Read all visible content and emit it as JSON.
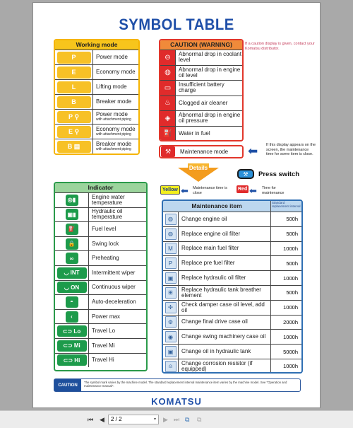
{
  "document": {
    "title": "SYMBOL TABLE",
    "brand": "KOMATSU",
    "working_mode": {
      "header": "Working mode",
      "items": [
        {
          "symbol": "P",
          "label": "Power mode",
          "sub": ""
        },
        {
          "symbol": "E",
          "label": "Economy mode",
          "sub": ""
        },
        {
          "symbol": "L",
          "label": "Lifting mode",
          "sub": ""
        },
        {
          "symbol": "B",
          "label": "Breaker mode",
          "sub": ""
        },
        {
          "symbol": "P ⚲",
          "label": "Power mode",
          "sub": "with attachment piping"
        },
        {
          "symbol": "E ⚲",
          "label": "Economy mode",
          "sub": "with attachment piping"
        },
        {
          "symbol": "B ▤",
          "label": "Breaker mode",
          "sub": "with attachment piping"
        }
      ]
    },
    "caution": {
      "header": "CAUTION (WARNING)",
      "note": "If a caution display is given, contact your Komatsu distributor.",
      "items": [
        {
          "icon": "coolant-level-icon",
          "glyph": "⊖",
          "label": "Abnormal drop in coolant level"
        },
        {
          "icon": "engine-oil-level-icon",
          "glyph": "◍",
          "label": "Abnormal drop in engine oil level"
        },
        {
          "icon": "battery-icon",
          "glyph": "▭",
          "label": "Insufficient battery charge"
        },
        {
          "icon": "air-cleaner-icon",
          "glyph": "♨",
          "label": "Clogged air cleaner"
        },
        {
          "icon": "oil-pressure-icon",
          "glyph": "◈",
          "label": "Abnormal drop in engine oil pressure"
        },
        {
          "icon": "water-in-fuel-icon",
          "glyph": "⛽",
          "label": "Water in fuel"
        }
      ],
      "maintenance_mode": "Maintenance mode",
      "maintenance_note": "If this display appears on the screen, the maintenance time for some item is close."
    },
    "details": {
      "label": "Details",
      "press_switch": "Press switch",
      "yellow_tag": "Yellow",
      "yellow_note": "Maintenance time is close",
      "red_tag": "Red",
      "red_note": "Time for maintenance",
      "yellow_color": "#f2ee1c",
      "red_color": "#e02b2b"
    },
    "indicator": {
      "header": "Indicator",
      "items": [
        {
          "icon": "engine-water-temp-icon",
          "glyph": "◎▮",
          "label": "Engine water temperature"
        },
        {
          "icon": "hydraulic-oil-temp-icon",
          "glyph": "▣▮",
          "label": "Hydraulic oil temperature"
        },
        {
          "icon": "fuel-level-icon",
          "glyph": "⛽",
          "label": "Fuel level"
        },
        {
          "icon": "swing-lock-icon",
          "glyph": "🔒",
          "label": "Swing lock"
        },
        {
          "icon": "preheating-icon",
          "glyph": "∞",
          "label": "Preheating"
        },
        {
          "icon": "intermittent-wiper-icon",
          "glyph": "◡ INT",
          "label": "Intermittent wiper"
        },
        {
          "icon": "continuous-wiper-icon",
          "glyph": "◡ ON",
          "label": "Continuous wiper"
        },
        {
          "icon": "auto-deceleration-icon",
          "glyph": "◓",
          "label": "Auto-deceleration"
        },
        {
          "icon": "power-max-icon",
          "glyph": "‹",
          "label": "Power max"
        },
        {
          "icon": "travel-lo-icon",
          "glyph": "⊂⊃ Lo",
          "label": "Travel Lo"
        },
        {
          "icon": "travel-mi-icon",
          "glyph": "⊂⊃ Mi",
          "label": "Travel Mi"
        },
        {
          "icon": "travel-hi-icon",
          "glyph": "⊂⊃ Hi",
          "label": "Travel Hi"
        }
      ]
    },
    "maintenance": {
      "header": "Maintenance item",
      "interval_header": "Standard replacement interval",
      "items": [
        {
          "icon": "engine-oil-icon",
          "glyph": "◍",
          "label": "Change engine oil",
          "interval": "500h"
        },
        {
          "icon": "engine-oil-filter-icon",
          "glyph": "◍",
          "label": "Replace engine oil filter",
          "interval": "500h"
        },
        {
          "icon": "main-fuel-filter-icon",
          "glyph": "M",
          "label": "Replace main fuel filter",
          "interval": "1000h"
        },
        {
          "icon": "pre-fuel-filter-icon",
          "glyph": "P",
          "label": "Replace pre fuel filter",
          "interval": "500h"
        },
        {
          "icon": "hydraulic-oil-filter-icon",
          "glyph": "▣",
          "label": "Replace hydraulic oil filter",
          "interval": "1000h"
        },
        {
          "icon": "breather-element-icon",
          "glyph": "⊞",
          "label": "Replace hydraulic tank breather element",
          "interval": "500h"
        },
        {
          "icon": "damper-case-icon",
          "glyph": "✣",
          "label": "Check damper case oil level, add oil",
          "interval": "1000h"
        },
        {
          "icon": "final-drive-icon",
          "glyph": "⚙",
          "label": "Change final drive case oil",
          "interval": "2000h"
        },
        {
          "icon": "swing-machinery-icon",
          "glyph": "◉",
          "label": "Change swing machinery case oil",
          "interval": "1000h"
        },
        {
          "icon": "hydraulic-tank-icon",
          "glyph": "▣",
          "label": "Change oil in hydraulic tank",
          "interval": "5000h"
        },
        {
          "icon": "corrosion-resistor-icon",
          "glyph": "⍝",
          "label": "Change corrosion resistor (if equipped)",
          "interval": "1000h"
        }
      ]
    },
    "caution_footer": {
      "label": "CAUTION",
      "text": "The symbol mark varies by the machine model. The standard replacement interval maintenance item varies by the machine model. See \"Operation and maintenance manual\"."
    }
  },
  "toolbar": {
    "first_page": "⏮",
    "prev_page": "◀",
    "page_value": "2 / 2",
    "next_page": "▶",
    "last_page": "⏭",
    "single_page": "⧉",
    "two_page": "⧉"
  }
}
